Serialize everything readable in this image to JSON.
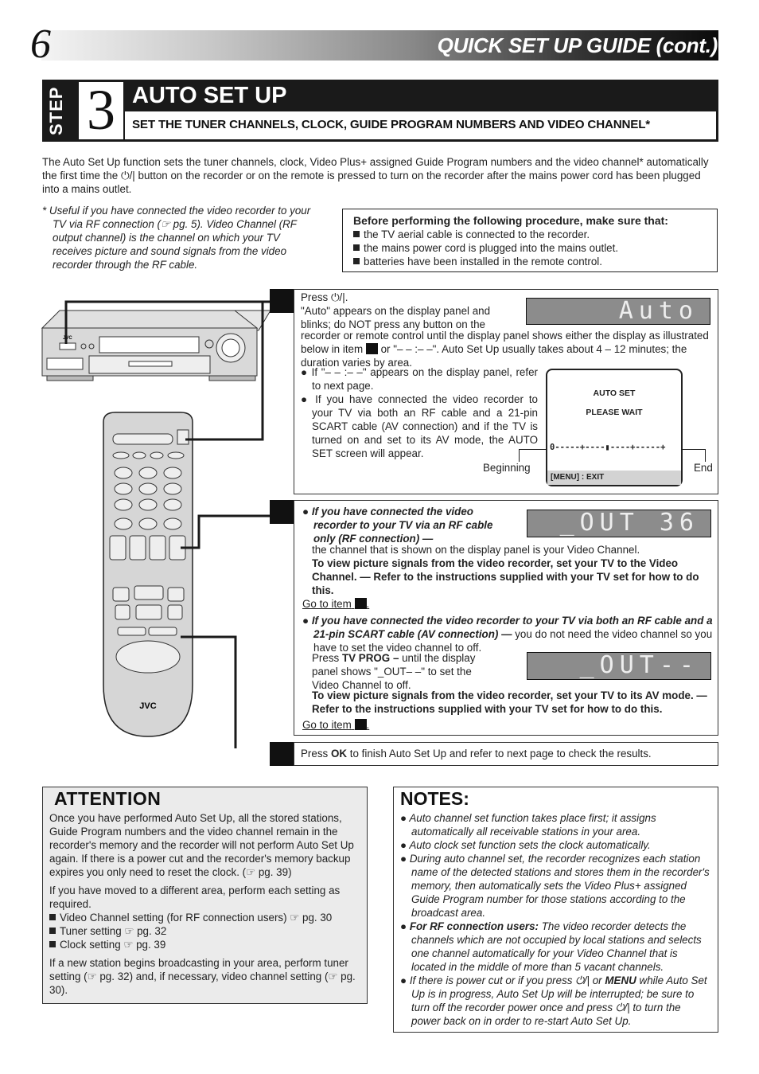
{
  "header": {
    "page_number": "6",
    "title": "QUICK SET UP GUIDE (cont.)"
  },
  "step": {
    "label": "STEP",
    "number": "3",
    "title": "AUTO SET UP",
    "subtitle": "SET THE TUNER CHANNELS, CLOCK, GUIDE PROGRAM NUMBERS AND VIDEO CHANNEL*"
  },
  "intro": {
    "text_before_icon": "The Auto Set Up function sets the tuner channels, clock, Video Plus+ assigned Guide Program numbers and the video channel* automatically the first time the ",
    "power_symbol": "⏻/|",
    "text_after_icon": " button on the recorder or on the remote is pressed to turn on the recorder after the mains power cord has been plugged into a mains outlet."
  },
  "footnote": {
    "text": "* Useful if you have connected the video recorder to your TV via RF connection (☞ pg. 5). Video Channel (RF output channel) is the channel on which your TV receives picture and sound signals from the video recorder through the RF cable."
  },
  "before_box": {
    "title": "Before performing the following procedure, make sure that:",
    "items": [
      "the TV aerial cable is connected to the recorder.",
      "the mains power cord is plugged into the mains outlet.",
      "batteries have been installed in the remote control."
    ]
  },
  "item1": {
    "press_prefix": "Press ",
    "power_symbol": "⏻/|",
    "press_suffix": ".",
    "line1": "\"Auto\" appears on the display panel and",
    "line2": "blinks; do NOT press any button on the",
    "line3_a": "recorder or remote control until the display panel shows either the display as illustrated below in item ",
    "line3_b": " or \"– – :– –\".  Auto Set Up usually takes about 4 – 12 minutes; the duration varies by area.",
    "bullet1": "If \"– – :– –\" appears on the display panel, refer to next page.",
    "bullet2": "If you have connected the video recorder to your TV via both an RF cable and a 21-pin SCART cable (AV connection) and if the TV is turned on and set to its AV mode, the AUTO SET screen will appear.",
    "lcd_text": "Auto",
    "osd": {
      "title": "AUTO SET",
      "status": "PLEASE WAIT",
      "progress_bar": "0-----+----▮----+-----+",
      "progress_fraction": 0.5,
      "footer": "[MENU] : EXIT",
      "label_begin": "Beginning",
      "label_end": "End"
    }
  },
  "item2": {
    "case1_title": "If you have connected the video recorder to your TV via an RF cable only (RF connection) —",
    "case1_text": "the channel that is shown on the display panel is your Video Channel.",
    "case1_bold": "To view picture signals from the video recorder, set your TV to the Video Channel. — Refer to the instructions supplied with your TV set for how to do this.",
    "goto1": "Go to item",
    "lcd1_text": "_OUT 36",
    "case2_title": "If you have connected the video recorder to your TV via both an RF cable and a 21-pin SCART cable (AV connection) —",
    "case2_text": " you do not need the video channel so you have to set the video channel to off.",
    "case2_press": "Press ",
    "case2_key": "TV PROG –",
    "case2_press_rest": " until the display panel shows \"_OUT– –\" to set the Video Channel to off.",
    "case2_bold": "To view picture signals from the video recorder, set your TV to its AV mode. — Refer to the instructions supplied with your TV set for how to do this.",
    "goto2": "Go to item",
    "lcd2_text": "_OUT--"
  },
  "item3": {
    "press": "Press ",
    "key": "OK",
    "rest": " to finish Auto Set Up and refer to next page to check the results."
  },
  "attention": {
    "title": "ATTENTION",
    "para1": "Once you have performed Auto Set Up, all the stored stations, Guide Program numbers and the video channel remain in the recorder's memory and the recorder will not perform Auto Set Up again. If there is a power cut and the recorder's memory backup expires you only need to reset the clock. (☞ pg. 39)",
    "para2": "If you have moved to a different area, perform each setting as required.",
    "list": [
      "Video Channel setting (for RF connection users) ☞ pg. 30",
      "Tuner setting ☞ pg. 32",
      "Clock setting ☞ pg. 39"
    ],
    "para3": "If a new station begins broadcasting in your area, perform tuner setting (☞ pg. 32) and, if necessary, video channel setting  (☞ pg. 30)."
  },
  "notes": {
    "title": "NOTES:",
    "items": [
      "Auto channel set function takes place first; it assigns automatically all receivable stations in your area.",
      "Auto clock set function sets the clock automatically.",
      "During auto channel set, the recorder recognizes each station name of the detected stations and stores them in the recorder's memory, then automatically sets the Video Plus+ assigned Guide Program number for those stations according to the broadcast area."
    ],
    "rf_bold": "For RF connection users:",
    "rf_text": " The video recorder detects the channels which are not occupied by local stations and selects one channel automatically for your Video Channel that is located in the middle of more than 5 vacant channels.",
    "power_a": "If there is power cut or if you press ",
    "power_symbol": "⏻/|",
    "power_b": " or ",
    "power_menu": "MENU",
    "power_c": " while Auto Set Up is in progress, Auto Set Up will be interrupted; be sure to turn off the recorder power once and press ",
    "power_d": " to turn the power back on in order to re-start Auto Set Up."
  },
  "illustration": {
    "vcr_brand": "JVC",
    "remote_brand": "JVC"
  }
}
